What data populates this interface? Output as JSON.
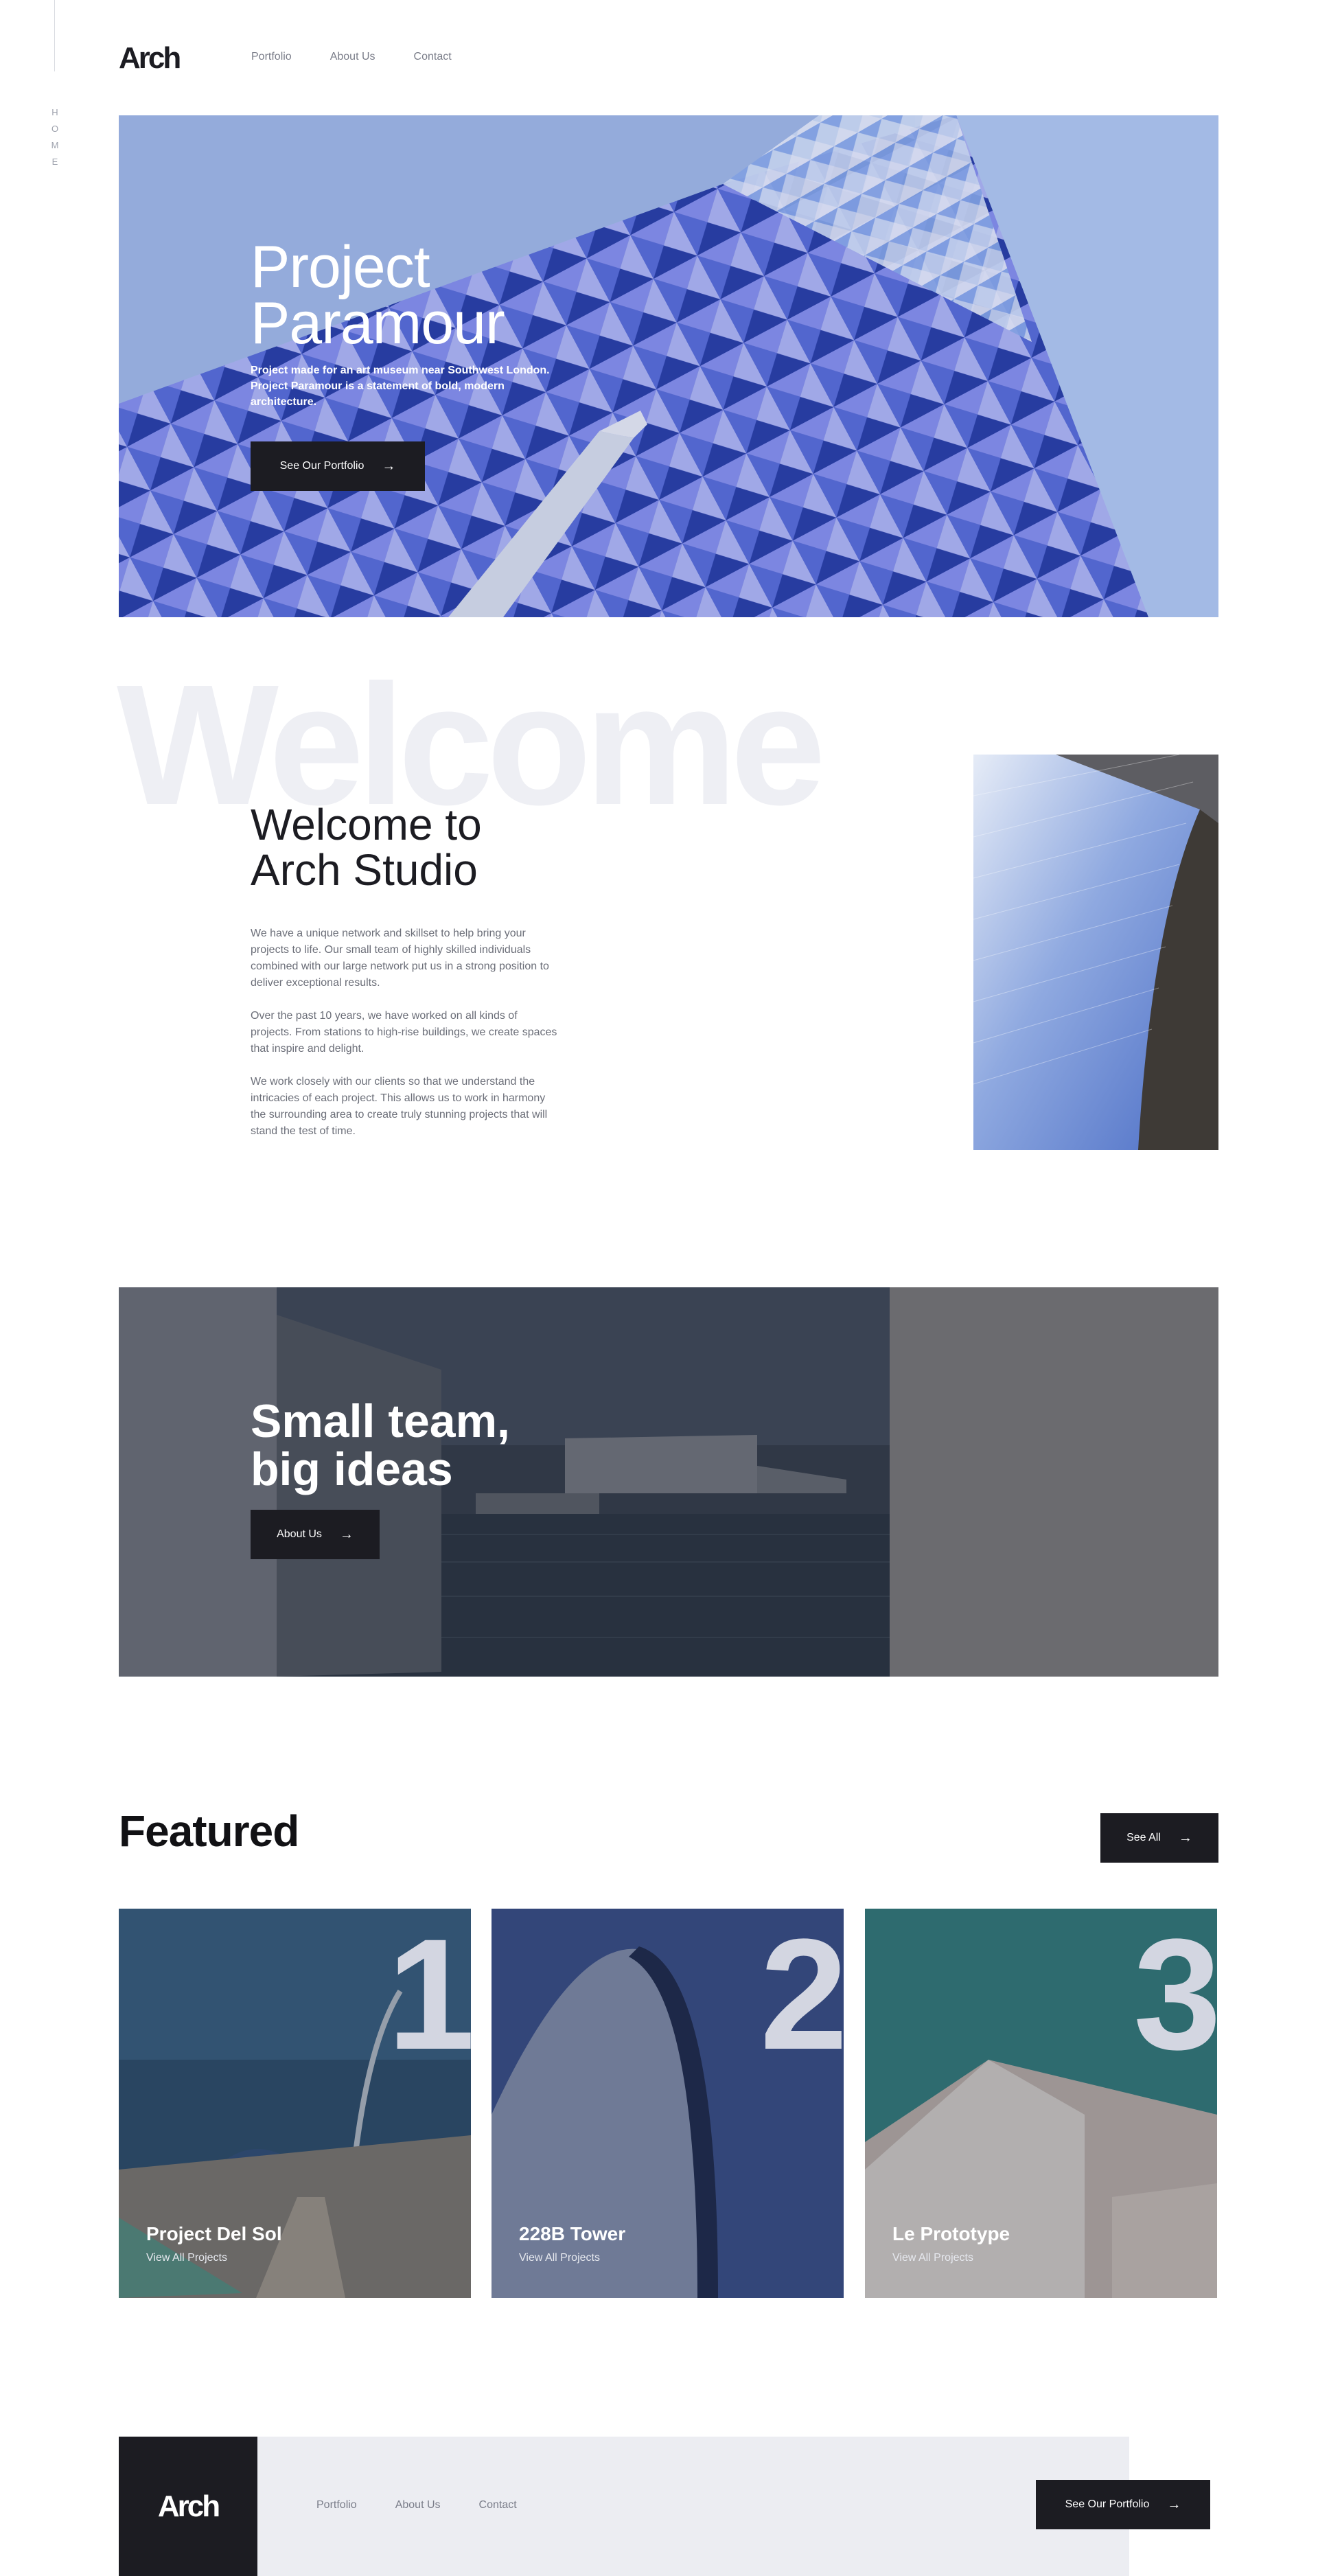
{
  "side": {
    "label": "HOME"
  },
  "header": {
    "logo": "Arch",
    "nav": [
      "Portfolio",
      "About Us",
      "Contact"
    ]
  },
  "hero": {
    "title_line1": "Project",
    "title_line2": "Paramour",
    "description": "Project made for an art museum near Southwest London. Project Paramour is a statement of bold, modern architecture.",
    "button_label": "See Our Portfolio"
  },
  "welcome": {
    "bg_word": "Welcome",
    "title_line1": "Welcome to",
    "title_line2": "Arch Studio",
    "paragraphs": [
      "We have a unique network and skillset to help bring your projects to life. Our small team of highly skilled individuals combined with our large network put us in a strong position to deliver exceptional results.",
      "Over the past 10 years, we have worked on all kinds of projects. From stations to high-rise buildings, we create spaces that inspire and delight.",
      "We work closely with our clients so that we understand the intricacies of each project. This allows us to work in harmony the surrounding area to create truly stunning projects that will stand the test of time."
    ]
  },
  "team": {
    "title_line1": "Small team,",
    "title_line2": "big ideas",
    "button_label": "About Us"
  },
  "featured": {
    "title": "Featured",
    "see_all_label": "See All",
    "cards": [
      {
        "number": "1",
        "name": "Project Del Sol",
        "link": "View All Projects"
      },
      {
        "number": "2",
        "name": "228B Tower",
        "link": "View All Projects"
      },
      {
        "number": "3",
        "name": "Le Prototype",
        "link": "View All Projects"
      }
    ]
  },
  "footer": {
    "logo": "Arch",
    "nav": [
      "Portfolio",
      "About Us",
      "Contact"
    ],
    "button_label": "See Our Portfolio"
  },
  "icons": {
    "arrow": "arrow-right-icon"
  },
  "colors": {
    "dark": "#1c1c22",
    "muted": "#7a7d89",
    "light_bg": "#ecedf2"
  }
}
